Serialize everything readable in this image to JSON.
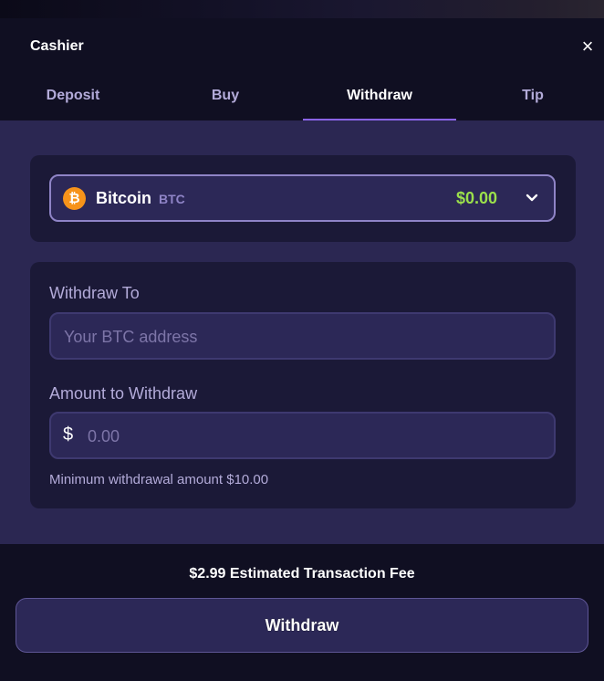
{
  "header": {
    "title": "Cashier",
    "close_icon": "×"
  },
  "tabs": [
    {
      "label": "Deposit",
      "active": false
    },
    {
      "label": "Buy",
      "active": false
    },
    {
      "label": "Withdraw",
      "active": true
    },
    {
      "label": "Tip",
      "active": false
    }
  ],
  "currency": {
    "icon": "₿",
    "name": "Bitcoin",
    "ticker": "BTC",
    "balance": "$0.00",
    "icon_name": "bitcoin-icon",
    "balance_color": "#9be04b"
  },
  "withdraw_to": {
    "label": "Withdraw To",
    "placeholder": "Your BTC address",
    "value": ""
  },
  "amount": {
    "label": "Amount to Withdraw",
    "prefix": "$",
    "placeholder": "0.00",
    "value": ""
  },
  "min_note": "Minimum withdrawal amount $10.00",
  "footer": {
    "fee_text": "$2.99 Estimated Transaction Fee",
    "button_label": "Withdraw"
  },
  "colors": {
    "accent": "#8a63e6",
    "panel": "#2b2752",
    "card": "#1b1937",
    "background": "#100f22"
  }
}
